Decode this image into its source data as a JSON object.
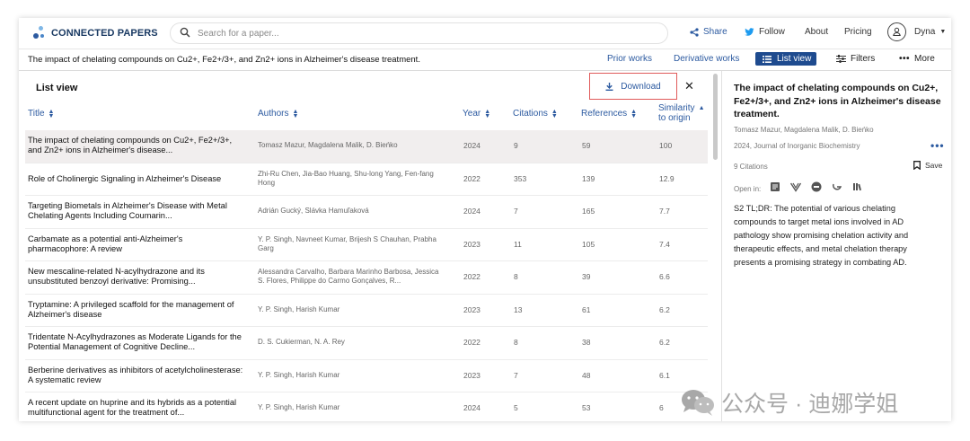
{
  "nav": {
    "brand": "CONNECTED PAPERS",
    "search_placeholder": "Search for a paper...",
    "share": "Share",
    "follow": "Follow",
    "about": "About",
    "pricing": "Pricing",
    "user": "Dyna"
  },
  "subbar": {
    "paper_title": "The impact of chelating compounds on Cu2+, Fe2+/3+, and Zn2+ ions in Alzheimer's disease treatment.",
    "prior_works": "Prior works",
    "derivative_works": "Derivative works",
    "list_view": "List view",
    "filters": "Filters",
    "more": "More"
  },
  "list": {
    "heading": "List view",
    "download": "Download",
    "columns": {
      "title": "Title",
      "authors": "Authors",
      "year": "Year",
      "citations": "Citations",
      "references": "References",
      "similarity": "Similarity",
      "similarity2": "to origin"
    },
    "rows": [
      {
        "title": "The impact of chelating compounds on Cu2+, Fe2+/3+, and Zn2+ ions in Alzheimer's disease...",
        "authors": "Tomasz Mazur, Magdalena Malik, D. Bieńko",
        "year": "2024",
        "citations": "9",
        "references": "59",
        "similarity": "100"
      },
      {
        "title": "Role of Cholinergic Signaling in Alzheimer's Disease",
        "authors": "Zhi-Ru Chen, Jia-Bao Huang, Shu-long Yang, Fen-fang Hong",
        "year": "2022",
        "citations": "353",
        "references": "139",
        "similarity": "12.9"
      },
      {
        "title": "Targeting Biometals in Alzheimer's Disease with Metal Chelating Agents Including Coumarin...",
        "authors": "Adrián Gucký, Slávka Hamuľaková",
        "year": "2024",
        "citations": "7",
        "references": "165",
        "similarity": "7.7"
      },
      {
        "title": "Carbamate as a potential anti-Alzheimer's pharmacophore: A review",
        "authors": "Y. P. Singh, Navneet Kumar, Brijesh S Chauhan, Prabha Garg",
        "year": "2023",
        "citations": "11",
        "references": "105",
        "similarity": "7.4"
      },
      {
        "title": "New mescaline-related N-acylhydrazone and its unsubstituted benzoyl derivative: Promising...",
        "authors": "Alessandra Carvalho, Barbara Marinho Barbosa, Jessica S. Flores, Philippe do Carmo Gonçalves, R...",
        "year": "2022",
        "citations": "8",
        "references": "39",
        "similarity": "6.6"
      },
      {
        "title": "Tryptamine: A privileged scaffold for the management of Alzheimer's disease",
        "authors": "Y. P. Singh, Harish Kumar",
        "year": "2023",
        "citations": "13",
        "references": "61",
        "similarity": "6.2"
      },
      {
        "title": "Tridentate N-Acylhydrazones as Moderate Ligands for the Potential Management of Cognitive Decline...",
        "authors": "D. S. Cukierman, N. A. Rey",
        "year": "2022",
        "citations": "8",
        "references": "38",
        "similarity": "6.2"
      },
      {
        "title": "Berberine derivatives as inhibitors of acetylcholinesterase: A systematic review",
        "authors": "Y. P. Singh, Harish Kumar",
        "year": "2023",
        "citations": "7",
        "references": "48",
        "similarity": "6.1"
      },
      {
        "title": "A recent update on huprine and its hybrids as a potential multifunctional agent for the treatment of...",
        "authors": "Y. P. Singh, Harish Kumar",
        "year": "2024",
        "citations": "5",
        "references": "53",
        "similarity": "6"
      }
    ]
  },
  "detail": {
    "title": "The impact of chelating compounds on Cu2+, Fe2+/3+, and Zn2+ ions in Alzheimer's disease treatment.",
    "authors": "Tomasz Mazur, Magdalena Malik, D. Bieńko",
    "journal": "2024, Journal of Inorganic Biochemistry",
    "citations": "9 Citations",
    "save": "Save",
    "open_in": "Open in:",
    "tldr": "S2 TL;DR: The potential of various chelating compounds to target metal ions involved in AD pathology show promising chelation activity and therapeutic effects, and metal chelation therapy presents a promising strategy in combating AD."
  },
  "watermark": "公众号 · 迪娜学姐",
  "colors": {
    "accent": "#2c5aa0",
    "brand": "#1a3a63",
    "list_view_bg": "#1e4b8f",
    "highlight_border": "#e05a5a"
  }
}
